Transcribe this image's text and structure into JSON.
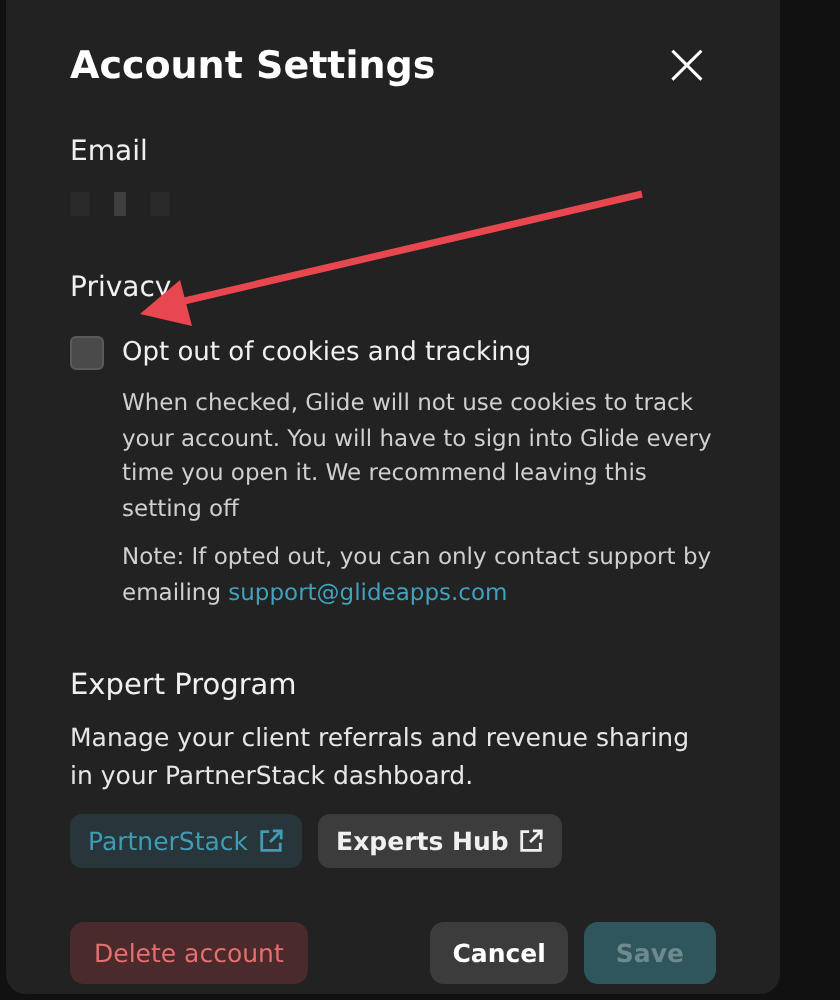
{
  "dialog": {
    "title": "Account Settings",
    "close": "×"
  },
  "email": {
    "label": "Email"
  },
  "privacy": {
    "heading": "Privacy",
    "option": {
      "label": "Opt out of cookies and tracking",
      "checked": false
    },
    "description": "When checked, Glide will not use cookies to track your account. You will have to sign into Glide every time you open it. We recommend leaving this setting off",
    "note": "Note: If opted out, you can only contact support by emailing",
    "link": "support@glideapps.com"
  },
  "expert_program": {
    "heading": "Expert Program",
    "description": "Manage your client referrals and revenue sharing in your PartnerStack dashboard.",
    "links": [
      {
        "label": "PartnerStack",
        "kind": "accent"
      },
      {
        "label": "Experts Hub",
        "kind": "neutral"
      }
    ]
  },
  "footer": {
    "buttons": [
      {
        "label": "Delete account",
        "kind": "danger",
        "disabled": false
      },
      {
        "label": "Cancel",
        "kind": "neutral",
        "disabled": false
      },
      {
        "label": "Save",
        "kind": "primary",
        "disabled": true
      }
    ]
  }
}
